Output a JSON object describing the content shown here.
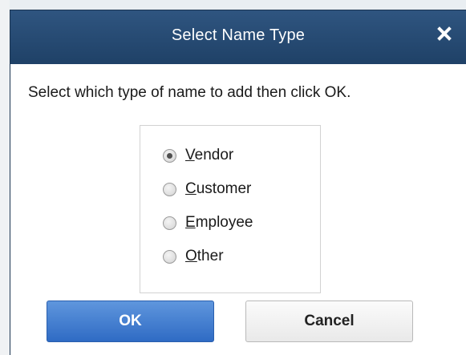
{
  "dialog": {
    "title": "Select Name Type",
    "instruction": "Select which type of name to add then click OK.",
    "close_icon": "close-icon"
  },
  "options": [
    {
      "accel": "V",
      "rest": "endor",
      "checked": true
    },
    {
      "accel": "C",
      "rest": "ustomer",
      "checked": false
    },
    {
      "accel": "E",
      "rest": "mployee",
      "checked": false
    },
    {
      "accel": "O",
      "rest": "ther",
      "checked": false
    }
  ],
  "buttons": {
    "ok_label": "OK",
    "cancel_label": "Cancel"
  },
  "colors": {
    "titlebar": "#1f4167",
    "ok_button": "#2f6bc4"
  }
}
